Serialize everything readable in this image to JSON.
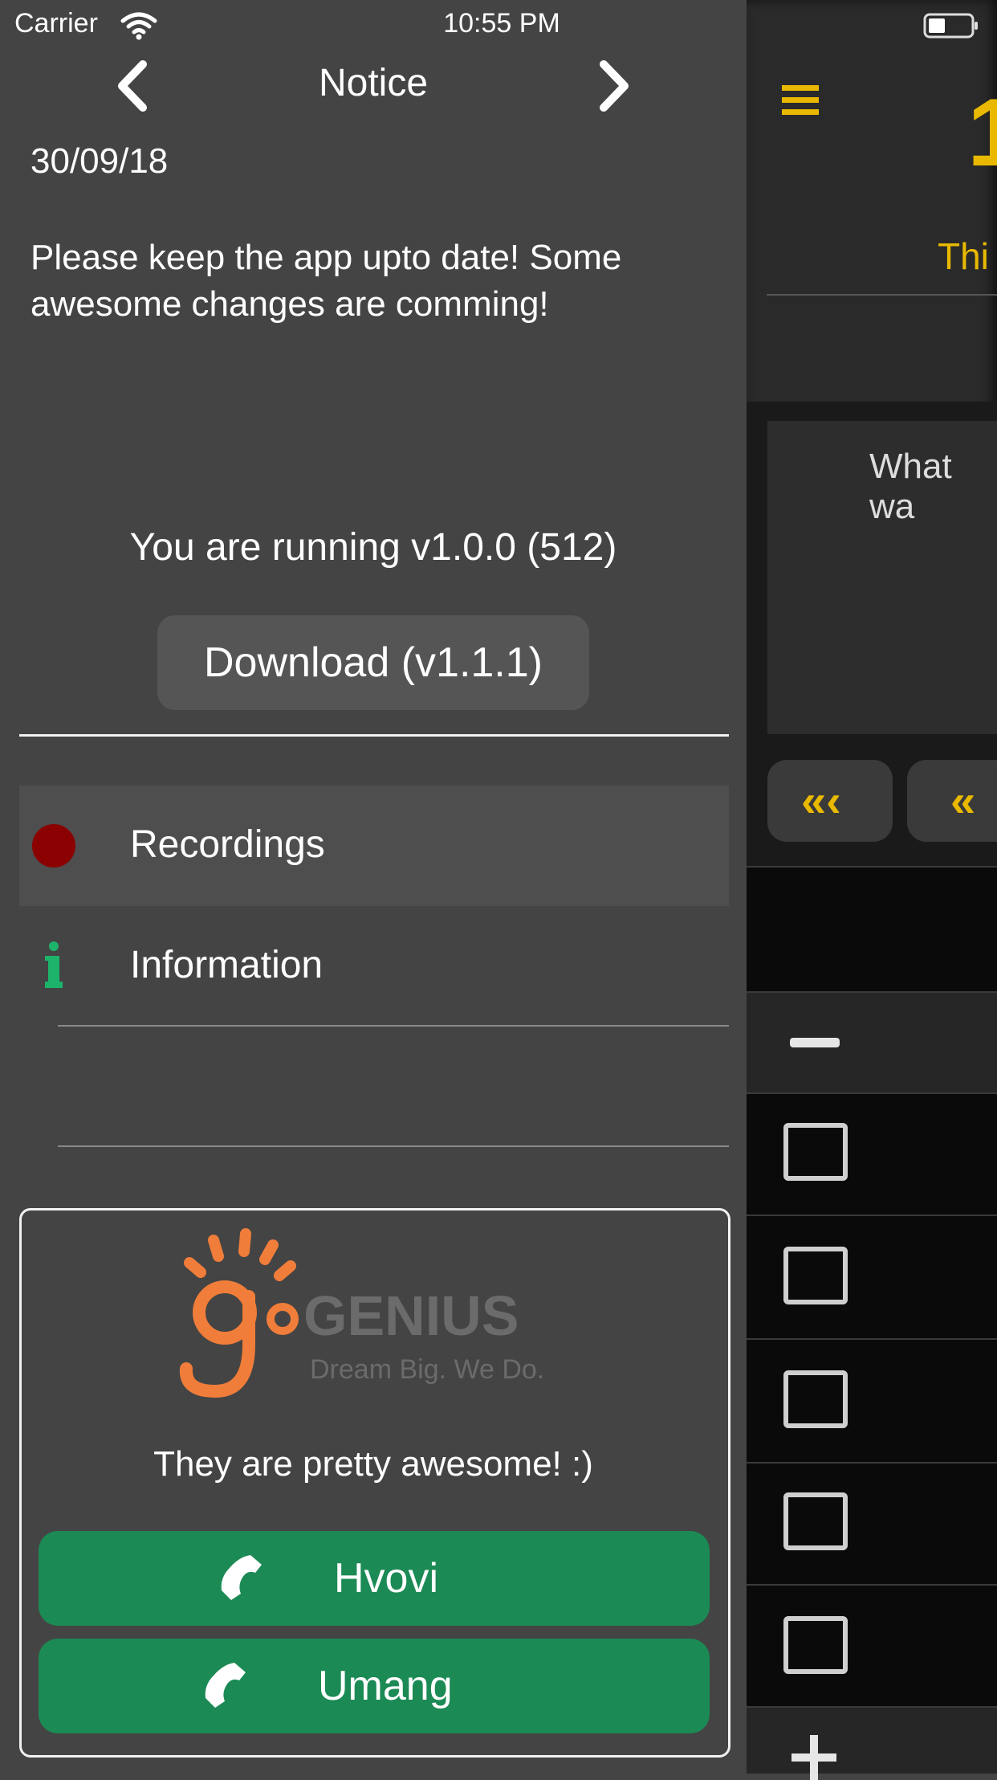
{
  "status_bar": {
    "carrier": "Carrier",
    "time": "10:55 PM"
  },
  "nav": {
    "title": "Notice",
    "prev_icon": "chevron-left-icon",
    "next_icon": "chevron-right-icon"
  },
  "notice": {
    "date": "30/09/18",
    "message": "Please keep the app upto date! Some awesome changes are comming!"
  },
  "update": {
    "running": "You are running v1.0.0 (512)",
    "download_label": "Download (v1.1.1)"
  },
  "menu": {
    "items": [
      {
        "label": "Recordings",
        "icon": "record-dot-icon",
        "icon_color": "#8b0000"
      },
      {
        "label": "Information",
        "icon": "info-icon",
        "icon_color": "#1db36b"
      }
    ]
  },
  "sponsor": {
    "logo_brand": "GENIUS",
    "logo_tagline": "Dream Big. We Do.",
    "message": "They are pretty awesome! :)",
    "buttons": [
      {
        "label": "Hvovi",
        "icon": "phone-icon"
      },
      {
        "label": "Umang",
        "icon": "phone-icon"
      }
    ]
  },
  "right_panel": {
    "number_fragment": "1",
    "heading_fragment": "Thi",
    "prompt_fragment": "What wa",
    "rewind_far_label": "«‹",
    "rewind_label": "«"
  },
  "colors": {
    "accent_yellow": "#e8b900",
    "call_green": "#1c8a55",
    "record_red": "#8b0000",
    "info_green": "#1db36b"
  }
}
